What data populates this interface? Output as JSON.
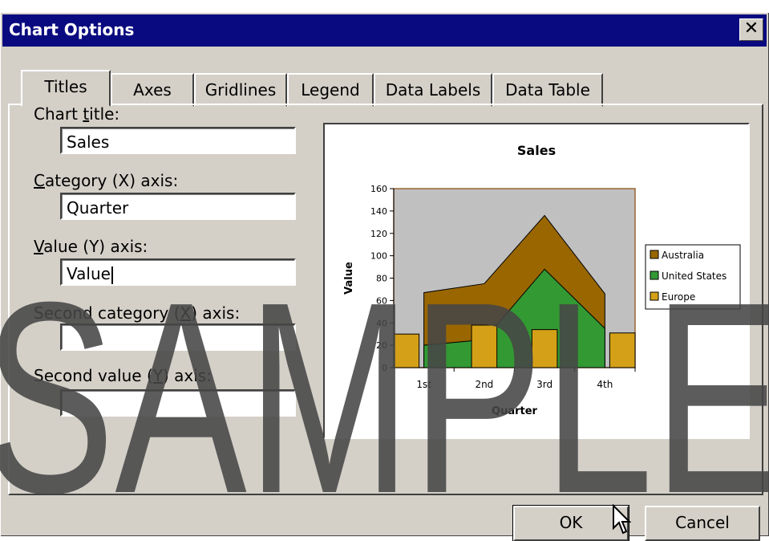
{
  "window": {
    "title": "Chart Options",
    "close": "✕"
  },
  "tabs": [
    "Titles",
    "Axes",
    "Gridlines",
    "Legend",
    "Data Labels",
    "Data Table"
  ],
  "fields": {
    "chart_title": {
      "label_pre": "Chart ",
      "label_u": "t",
      "label_post": "itle:",
      "value": "Sales"
    },
    "category_x": {
      "label_pre": "",
      "label_u": "C",
      "label_post": "ategory (X) axis:",
      "value": "Quarter"
    },
    "value_y": {
      "label_pre": "",
      "label_u": "V",
      "label_post": "alue (Y) axis:",
      "value": "Value"
    },
    "second_category_x": {
      "label_pre": "Second category (",
      "label_u": "X",
      "label_post": ") axis:",
      "value": ""
    },
    "second_value_y": {
      "label_pre": "Second value (",
      "label_u": "Y",
      "label_post": ") axis:",
      "value": ""
    }
  },
  "buttons": {
    "ok": "OK",
    "cancel": "Cancel"
  },
  "watermark": "SAMPLE",
  "chart_data": {
    "type": "area",
    "title": "Sales",
    "xlabel": "Quarter",
    "ylabel": "Value",
    "categories": [
      "1st",
      "2nd",
      "3rd",
      "4th"
    ],
    "ylim": [
      0,
      160
    ],
    "yticks": [
      0,
      20,
      40,
      60,
      80,
      100,
      120,
      140,
      160
    ],
    "series": [
      {
        "name": "Australia",
        "type": "area",
        "values": [
          67,
          75,
          136,
          66
        ],
        "color": "#996600"
      },
      {
        "name": "United States",
        "type": "area",
        "values": [
          20,
          25,
          88,
          35
        ],
        "color": "#339933"
      },
      {
        "name": "Europe",
        "type": "bar",
        "values": [
          30,
          38,
          34,
          31
        ],
        "color": "#d4a017"
      }
    ],
    "legend_position": "right"
  }
}
